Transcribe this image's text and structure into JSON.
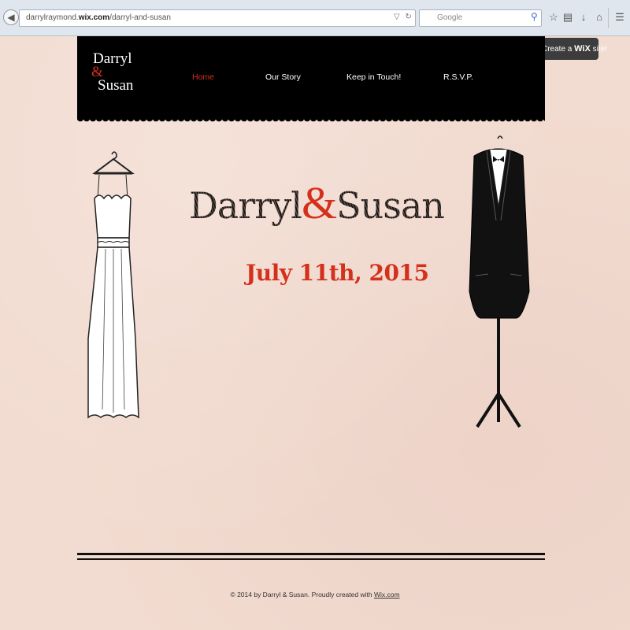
{
  "browser": {
    "url_prefix": "darrylraymond.",
    "url_domain": "wix.com",
    "url_path": "/darryl-and-susan",
    "search_placeholder": "Google",
    "search_engine_icon": "google-icon",
    "toolbar_icons": [
      "star-icon",
      "reading-list-icon",
      "download-icon",
      "home-icon",
      "menu-icon"
    ]
  },
  "wix_badge": {
    "prefix": "Create a",
    "brand": "WiX",
    "suffix": "site!"
  },
  "site": {
    "logo_line1": "Darryl",
    "logo_amp": "&",
    "logo_line2": "Susan",
    "nav": [
      {
        "label": "Home",
        "active": true
      },
      {
        "label": "Our Story",
        "active": false
      },
      {
        "label": "Keep in Touch!",
        "active": false
      },
      {
        "label": "R.S.V.P.",
        "active": false
      }
    ],
    "title_first": "Darryl",
    "title_amp": "&",
    "title_second": "Susan",
    "date": "July 11th, 2015",
    "footer_text": "© 2014 by Darryl & Susan. Proudly created with ",
    "footer_link": "Wix.com"
  },
  "colors": {
    "accent": "#d4311c",
    "header_bg": "#000000",
    "page_bg": "#f2dbd0"
  }
}
